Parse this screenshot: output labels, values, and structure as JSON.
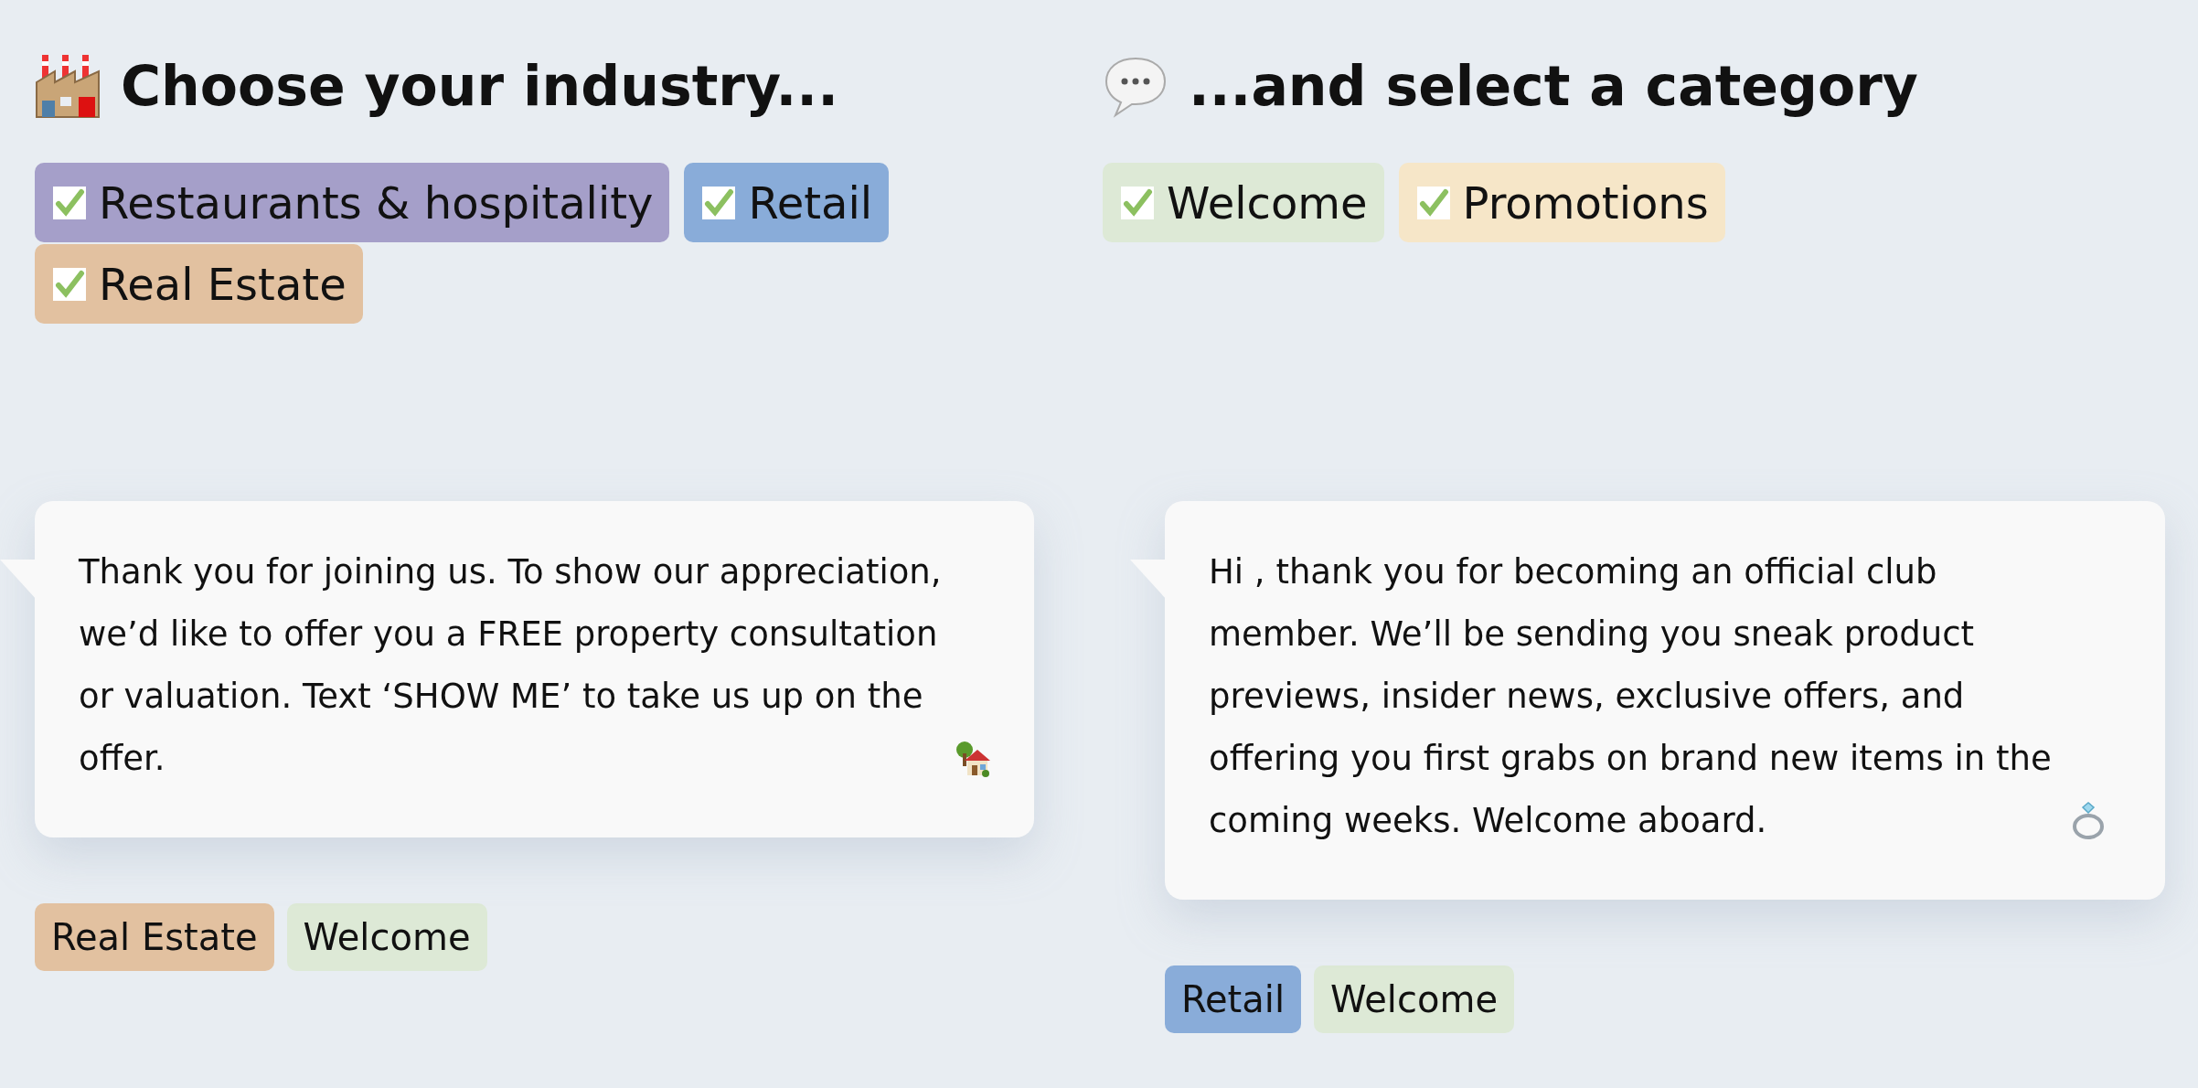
{
  "industry": {
    "heading": "Choose your industry...",
    "options": [
      {
        "label": "Restaurants & hospitality",
        "checked": true,
        "color": "#a59fc9"
      },
      {
        "label": "Retail",
        "checked": true,
        "color": "#89acd9"
      },
      {
        "label": "Real Estate",
        "checked": true,
        "color": "#e2c1a0"
      }
    ]
  },
  "category": {
    "heading": "...and select a category",
    "options": [
      {
        "label": "Welcome",
        "checked": true,
        "color": "#dde9d6"
      },
      {
        "label": "Promotions",
        "checked": true,
        "color": "#f6e6c8"
      }
    ]
  },
  "messages": [
    {
      "text": "Thank you for joining us. To show our appreciation, we’d like to offer you a FREE property consultation or valuation. Text ‘SHOW ME’ to take us up on the offer.",
      "tags": [
        {
          "label": "Real Estate",
          "color": "#e2c1a0"
        },
        {
          "label": "Welcome",
          "color": "#dde9d6"
        }
      ]
    },
    {
      "text": "Hi , thank you for becoming an official club member. We’ll be sending you sneak product previews, insider news, exclusive offers, and offering you first grabs on brand new items in the coming weeks. Welcome aboard. ",
      "tags": [
        {
          "label": "Retail",
          "color": "#89acd9"
        },
        {
          "label": "Welcome",
          "color": "#dde9d6"
        }
      ]
    }
  ]
}
